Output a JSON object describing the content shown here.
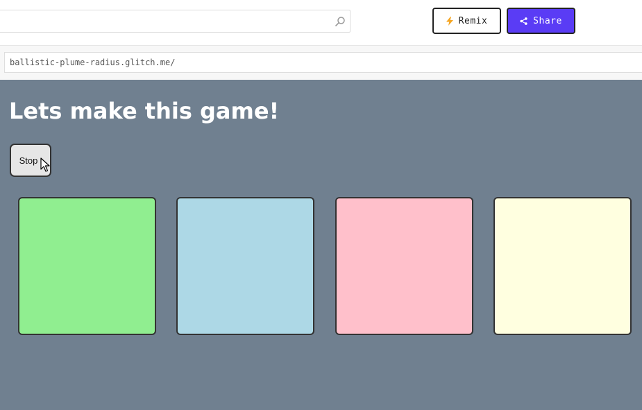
{
  "toolbar": {
    "remix_label": "Remix",
    "share_label": "Share",
    "remix_icon": "lightning-icon",
    "share_icon": "share-icon"
  },
  "address": {
    "url": "ballistic-plume-radius.glitch.me/"
  },
  "game": {
    "title": "Lets make this game!",
    "stop_label": "Stop",
    "tiles": [
      {
        "color": "#90ee90"
      },
      {
        "color": "#add8e6"
      },
      {
        "color": "#ffc0cb"
      },
      {
        "color": "#ffffe0"
      }
    ]
  },
  "colors": {
    "app_background": "#708090",
    "share_accent": "#5a3cf5",
    "remix_bolt": "#f5a623"
  }
}
